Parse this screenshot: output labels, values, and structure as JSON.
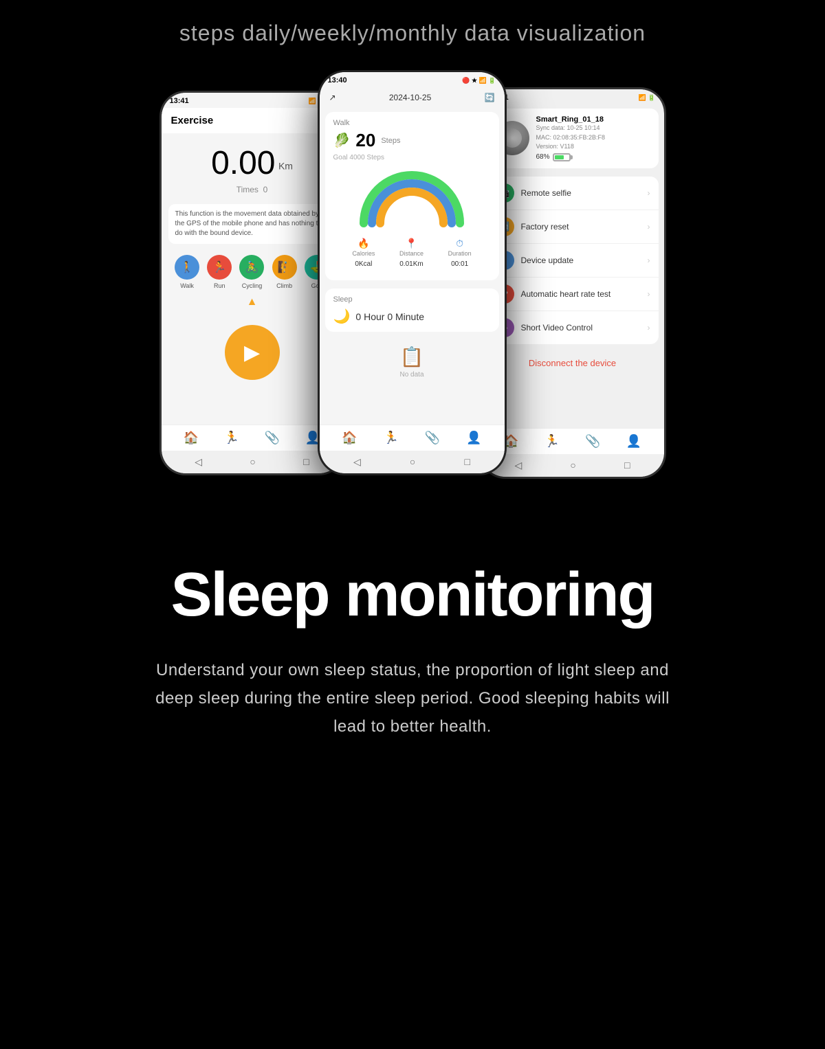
{
  "header": {
    "text": "steps daily/weekly/monthly data visualization"
  },
  "phones": {
    "left": {
      "status": {
        "time": "13:41",
        "icons": "🔴 ★ ✦ 📶 🔋51"
      },
      "title": "Exercise",
      "distance": "0.00",
      "unit": "Km",
      "times_label": "Times",
      "times_value": "0",
      "note": "This function is the movement data obtained by the GPS of the mobile phone and has nothing to do with the bound device.",
      "modes": [
        {
          "label": "Walk",
          "color": "#4a90d9",
          "icon": "🚶"
        },
        {
          "label": "Run",
          "color": "#e74c3c",
          "icon": "🏃"
        },
        {
          "label": "Cycling",
          "color": "#27ae60",
          "icon": "🚴"
        },
        {
          "label": "Climb",
          "color": "#f39c12",
          "icon": "🧗"
        },
        {
          "label": "Golf",
          "color": "#1abc9c",
          "icon": "⛳"
        }
      ],
      "nav": [
        "🏠",
        "🏃",
        "📎",
        "👤"
      ]
    },
    "center": {
      "status": {
        "time": "13:40",
        "icons": "🔴 ★"
      },
      "date": "2024-10-25",
      "walk_label": "Walk",
      "walk_icon": "🥬",
      "steps": "20",
      "steps_unit": "Steps",
      "goal": "Goal 4000 Steps",
      "stats": [
        {
          "icon": "🔥",
          "label": "Calories",
          "value": "0Kcal",
          "color": "#e74c3c"
        },
        {
          "icon": "📍",
          "label": "Distance",
          "value": "0.01Km",
          "color": "#27ae60"
        },
        {
          "icon": "⏱",
          "label": "Duration",
          "value": "00:01",
          "color": "#4a90d9"
        }
      ],
      "sleep_label": "Sleep",
      "sleep_icon": "🌙",
      "sleep_time": "0 Hour 0 Minute",
      "no_data": "No data",
      "nav": [
        "🏠",
        "🏃",
        "📎",
        "👤"
      ]
    },
    "right": {
      "status": {
        "time": "13:41",
        "icons": "🔴 ★ 📶 🔋"
      },
      "device_name": "Smart_Ring_01_18",
      "sync": "Sync data: 10-25 10:14",
      "mac": "MAC: 02:08:35:FB:2B:F8",
      "version": "Version: V118",
      "battery": "68%",
      "menu_items": [
        {
          "label": "Remote selfie",
          "icon": "📷",
          "color": "#27ae60"
        },
        {
          "label": "Factory reset",
          "icon": "🔄",
          "color": "#f5a623"
        },
        {
          "label": "Device update",
          "icon": "⬆",
          "color": "#4a90d9"
        },
        {
          "label": "Automatic heart rate test",
          "icon": "❤",
          "color": "#e74c3c"
        },
        {
          "label": "Short Video Control",
          "icon": "▶",
          "color": "#9b59b6"
        }
      ],
      "disconnect": "Disconnect the device",
      "nav": [
        "🏠",
        "🏃",
        "📎",
        "👤"
      ]
    }
  },
  "sleep_section": {
    "title": "Sleep monitoring",
    "description": "Understand your own sleep status, the proportion of light sleep and deep sleep during the entire sleep period. Good sleeping habits will lead to better health."
  }
}
